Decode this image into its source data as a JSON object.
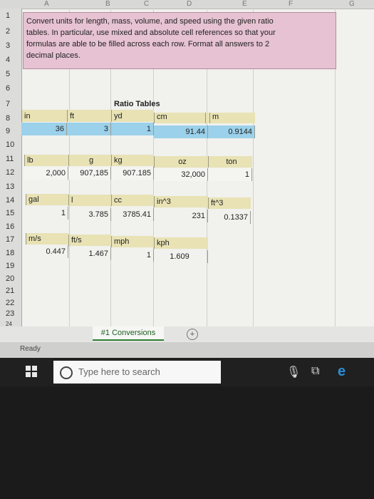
{
  "columns": [
    "A",
    "B",
    "C",
    "D",
    "E",
    "F",
    "G"
  ],
  "rows": [
    "1",
    "2",
    "3",
    "4",
    "5",
    "6",
    "7",
    "8",
    "9",
    "10",
    "11",
    "12",
    "13",
    "14",
    "15",
    "16",
    "17",
    "18",
    "19",
    "20",
    "21",
    "22",
    "23",
    "24"
  ],
  "instructions": {
    "line1": "Convert units for length, mass, volume, and speed using the given ratio",
    "line2": "tables. In particular, use mixed and absolute cell references so that your",
    "line3": "formulas are able to be filled across each row. Format all answers to 2",
    "line4": "decimal places."
  },
  "title": "Ratio Tables",
  "length": {
    "headers": [
      "in",
      "ft",
      "yd",
      "cm",
      "m"
    ],
    "values": [
      "36",
      "3",
      "1",
      "91.44",
      "0.9144"
    ]
  },
  "mass": {
    "headers": [
      "lb",
      "g",
      "kg",
      "oz",
      "ton"
    ],
    "values": [
      "2,000",
      "907,185",
      "907.185",
      "32,000",
      "1"
    ]
  },
  "volume": {
    "headers": [
      "gal",
      "l",
      "cc",
      "in^3",
      "ft^3"
    ],
    "values": [
      "1",
      "3.785",
      "3785.41",
      "231",
      "0.1337"
    ]
  },
  "speed": {
    "headers": [
      "m/s",
      "ft/s",
      "mph",
      "kph"
    ],
    "values": [
      "0.447",
      "1.467",
      "1",
      "1.609"
    ]
  },
  "sheet_tab": "#1 Conversions",
  "status": "Ready",
  "taskbar": {
    "search_placeholder": "Type here to search"
  }
}
